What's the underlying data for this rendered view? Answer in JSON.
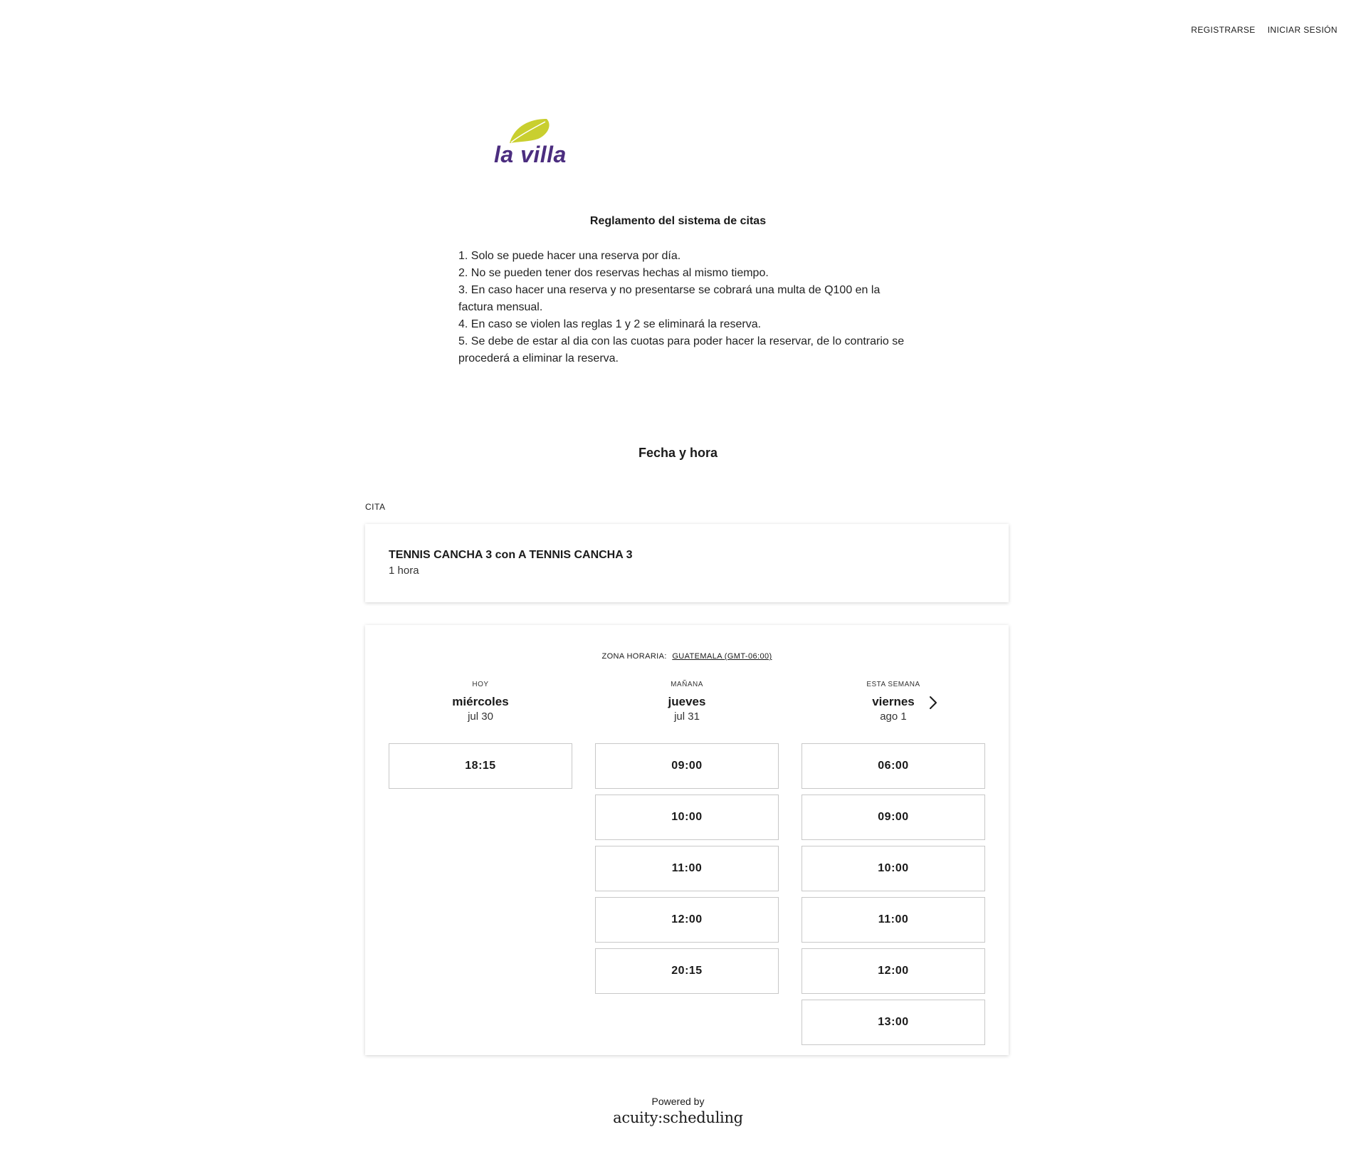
{
  "nav": {
    "register": "REGISTRARSE",
    "login": "INICIAR SESIÓN"
  },
  "logo": {
    "text": "la villa",
    "leaf_color": "#c9cf2f",
    "text_color": "#4b2d7f"
  },
  "rules": {
    "title": "Reglamento del sistema de citas",
    "lines": [
      "1. Solo se puede hacer una reserva por día.",
      "2. No se pueden tener dos reservas hechas al mismo tiempo.",
      "3. En caso hacer una reserva y no presentarse se cobrará una multa de Q100 en la factura mensual.",
      "4. En caso se violen las reglas 1 y 2 se eliminará la reserva.",
      "5. Se debe de estar al dia con las cuotas para poder hacer la reservar, de lo contrario se procederá a eliminar la reserva."
    ]
  },
  "section_title": "Fecha y hora",
  "appointment": {
    "label": "CITA",
    "name": "TENNIS CANCHA 3 con A TENNIS CANCHA 3",
    "duration": "1 hora"
  },
  "timezone": {
    "label": "ZONA HORARIA:",
    "value": "GUATEMALA (GMT-06:00)"
  },
  "days": [
    {
      "tag": "HOY",
      "day": "miércoles",
      "date": "jul 30",
      "slots": [
        "18:15"
      ]
    },
    {
      "tag": "MAÑANA",
      "day": "jueves",
      "date": "jul 31",
      "slots": [
        "09:00",
        "10:00",
        "11:00",
        "12:00",
        "20:15"
      ]
    },
    {
      "tag": "ESTA SEMANA",
      "day": "viernes",
      "date": "ago 1",
      "slots": [
        "06:00",
        "09:00",
        "10:00",
        "11:00",
        "12:00",
        "13:00"
      ]
    }
  ],
  "icons": {
    "next": "chevron-right-icon"
  },
  "footer": {
    "powered_by": "Powered by",
    "brand": "acuity:scheduling"
  }
}
